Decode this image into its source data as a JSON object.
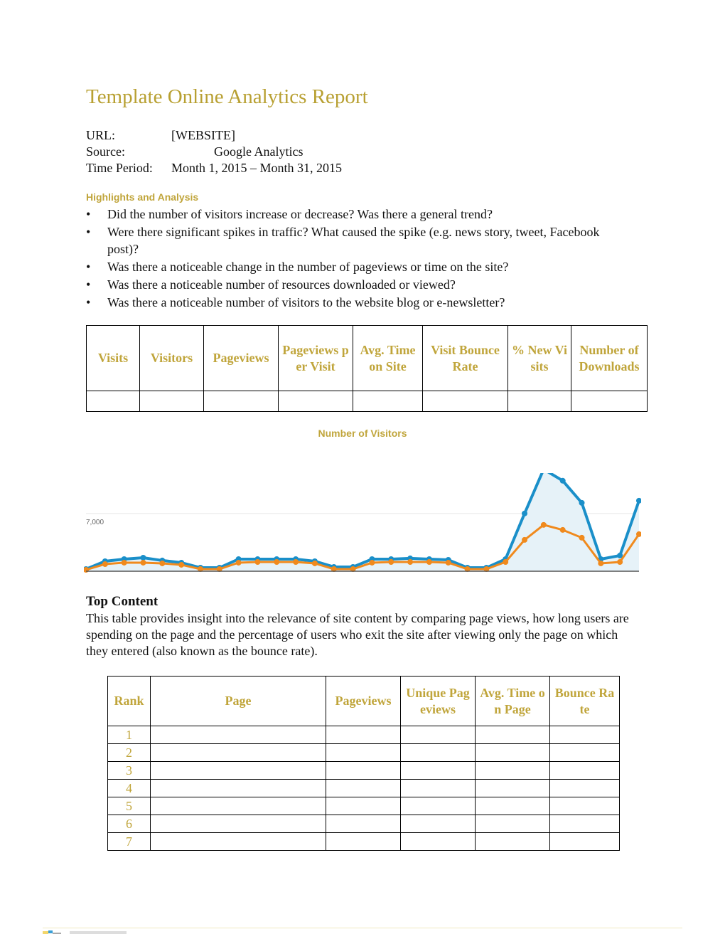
{
  "title": "Template Online Analytics Report",
  "meta": {
    "url_label": "URL:",
    "url_value": "[WEBSITE]",
    "source_label": "Source:",
    "source_value": "Google Analytics",
    "period_label": "Time Period:",
    "period_value": "Month 1, 2015 – Month 31, 2015"
  },
  "highlights": {
    "heading": "Highlights and Analysis",
    "items": [
      "Did the number of visitors increase or decrease? Was there a general trend?",
      "Were there significant spikes in traffic? What caused the spike (e.g. news story, tweet, Facebook post)?",
      "Was there a noticeable change in the number of pageviews or time on the site?",
      "Was there a noticeable number of resources downloaded or viewed?",
      "Was there a noticeable number of visitors to the website blog or e-newsletter?"
    ]
  },
  "summary_table": {
    "headers": [
      "Visits",
      "Visitors",
      "Pageviews",
      "Pageviews per Visit",
      "Avg. Time on Site",
      "Visit Bounce Rate",
      "% New Visits",
      "Number of Downloads"
    ]
  },
  "chart_data": {
    "type": "area",
    "title": "Number of Visitors",
    "y_tick_labels": [
      "7,000"
    ],
    "y_ticks": [
      7000
    ],
    "ylim": [
      0,
      11900
    ],
    "grid": true,
    "colors": {
      "series1": "#1a8fc9",
      "series2": "#f08a1d",
      "fill": "#e6f2f8"
    },
    "x": [
      1,
      2,
      3,
      4,
      5,
      6,
      7,
      8,
      9,
      10,
      11,
      12,
      13,
      14,
      15,
      16,
      17,
      18,
      19,
      20,
      21,
      22,
      23,
      24,
      25,
      26,
      27,
      28,
      29,
      30
    ],
    "series": [
      {
        "values": [
          260,
          1210,
          1470,
          1640,
          1300,
          1040,
          430,
          430,
          1470,
          1470,
          1470,
          1470,
          1210,
          520,
          520,
          1470,
          1470,
          1560,
          1470,
          1380,
          430,
          430,
          1470,
          7000,
          12360,
          10970,
          8290,
          1470,
          1900,
          8550
        ]
      },
      {
        "values": [
          170,
          860,
          1040,
          1040,
          950,
          780,
          260,
          260,
          1040,
          1120,
          1120,
          1120,
          950,
          260,
          260,
          1040,
          1120,
          1120,
          1120,
          1040,
          260,
          260,
          1120,
          3800,
          5620,
          5010,
          4060,
          950,
          1120,
          4490
        ]
      }
    ]
  },
  "top_content": {
    "heading": "Top Content",
    "body": "This table provides insight into the relevance of site content by comparing page views, how long users are spending on the page and the percentage of users who exit the site after viewing only the page on which they entered (also known as the bounce rate).",
    "headers": [
      "Rank",
      "Page",
      "Pageviews",
      "Unique Pageviews",
      "Avg. Time on Page",
      "Bounce Rate"
    ],
    "ranks": [
      "1",
      "2",
      "3",
      "4",
      "5",
      "6",
      "7"
    ]
  }
}
